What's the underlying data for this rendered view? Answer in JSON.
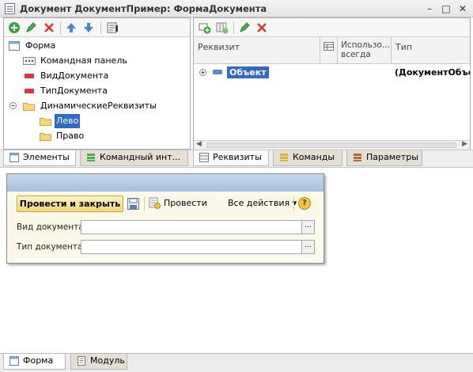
{
  "window": {
    "title": "Документ ДокументПример: ФормаДокумента",
    "min_glyph": "–",
    "max_glyph": "□",
    "close_glyph": "✕"
  },
  "left_panel": {
    "toolbar_icons": [
      "add-icon",
      "edit-icon",
      "delete-icon",
      "move-up-icon",
      "move-down-icon",
      "properties-icon"
    ],
    "tree": [
      {
        "label": "Форма",
        "icon": "form-icon",
        "level": 0
      },
      {
        "label": "Командная панель",
        "icon": "command-panel-icon",
        "level": 1
      },
      {
        "label": "ВидДокумента",
        "icon": "field-icon",
        "level": 1
      },
      {
        "label": "ТипДокумента",
        "icon": "field-icon",
        "level": 1
      },
      {
        "label": "ДинамическиеРеквизиты",
        "icon": "folder-icon",
        "level": 1,
        "expanded": true
      },
      {
        "label": "Лево",
        "icon": "folder-icon",
        "level": 2,
        "selected": true
      },
      {
        "label": "Право",
        "icon": "folder-icon",
        "level": 2
      }
    ],
    "tabs": [
      "Элементы",
      "Командный инт..."
    ]
  },
  "right_panel": {
    "toolbar_icons": [
      "add-attribute-icon",
      "add-column-icon",
      "edit-icon",
      "delete-icon"
    ],
    "columns": {
      "attribute": "Реквизит",
      "always_use": "Использо... всегда",
      "type": "Тип"
    },
    "row": {
      "name": "Объект",
      "type": "(ДокументОбъе"
    },
    "tabs": [
      "Реквизиты",
      "Команды",
      "Параметры"
    ]
  },
  "form_preview": {
    "post_close": "Провести и закрыть",
    "post": "Провести",
    "all_actions": "Все действия ▾",
    "help": "?",
    "fields": [
      {
        "label": "Вид документа:",
        "value": ""
      },
      {
        "label": "Тип документа:",
        "value": ""
      }
    ],
    "choice_glyph": "..."
  },
  "bottom_tabs": [
    "Форма",
    "Модуль"
  ],
  "colors": {
    "accent_selection": "#316ac5",
    "form_header": "#b6cde5",
    "form_bg": "#fbf9e9",
    "primary_button": "#f3d57a"
  }
}
